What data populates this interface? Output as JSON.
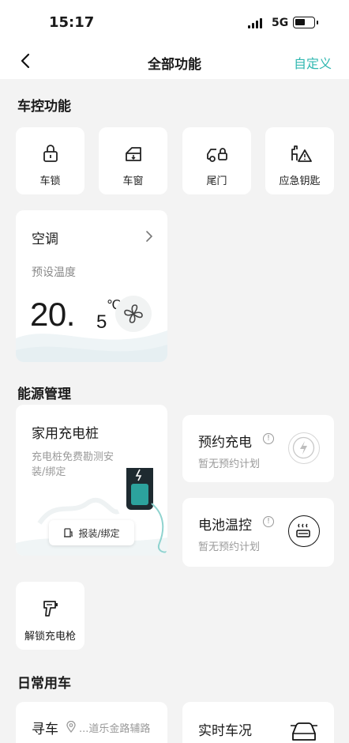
{
  "status_bar": {
    "time": "15:17",
    "network": "5G"
  },
  "nav": {
    "title": "全部功能",
    "customize": "自定义"
  },
  "sections": {
    "vehicle_control": "车控功能",
    "energy": "能源管理",
    "daily": "日常用车"
  },
  "vehicle_control": {
    "items": [
      {
        "label": "车锁",
        "icon": "lock-icon"
      },
      {
        "label": "车窗",
        "icon": "window-icon"
      },
      {
        "label": "尾门",
        "icon": "tailgate-icon"
      },
      {
        "label": "应急钥匙",
        "icon": "emergency-key-icon"
      }
    ],
    "ac": {
      "title": "空调",
      "subtitle": "预设温度",
      "temp_int": "20.",
      "temp_frac": "5",
      "unit": "℃"
    }
  },
  "energy": {
    "home_charger": {
      "title": "家用充电桩",
      "desc": "充电桩免费勘测安装/绑定",
      "button": "报装/绑定"
    },
    "scheduled": {
      "title": "预约充电",
      "info": "!",
      "subtitle": "暂无预约计划"
    },
    "battery": {
      "title": "电池温控",
      "info": "!",
      "subtitle": "暂无预约计划"
    },
    "unlock_gun": {
      "label": "解锁充电枪"
    }
  },
  "daily": {
    "find_car": {
      "title": "寻车",
      "location": "...道乐金路辅路"
    },
    "live_status": {
      "title": "实时车况"
    }
  },
  "colors": {
    "accent": "#2fb7b0",
    "background": "#f3f3f3"
  }
}
